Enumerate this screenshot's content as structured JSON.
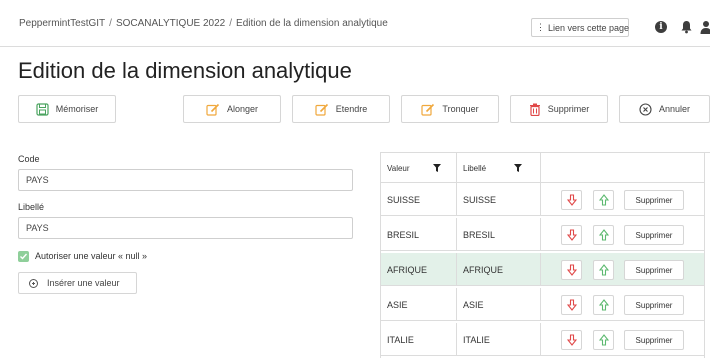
{
  "breadcrumb": [
    "PeppermintTestGIT",
    "SOCANALYTIQUE 2022",
    "Edition de la dimension analytique"
  ],
  "breadcrumb_separator": "/",
  "header": {
    "link_button": "Lien vers cette page",
    "link_icon": "hash-icon"
  },
  "page_title": "Edition de la dimension analytique",
  "toolbar": {
    "memorize": "Mémoriser",
    "lengthen": "Alonger",
    "extend": "Etendre",
    "truncate": "Tronquer",
    "delete": "Supprimer",
    "cancel": "Annuler"
  },
  "form": {
    "code_label": "Code",
    "code_value": "PAYS",
    "libelle_label": "Libellé",
    "libelle_value": "PAYS",
    "allow_null_label": "Autoriser une valeur « null »",
    "allow_null_checked": true,
    "insert_button": "Insérer une valeur"
  },
  "grid": {
    "columns": [
      "Valeur",
      "Libellé"
    ],
    "delete_label": "Supprimer",
    "rows": [
      {
        "valeur": "SUISSE",
        "libelle": "SUISSE",
        "selected": false
      },
      {
        "valeur": "BRESIL",
        "libelle": "BRESIL",
        "selected": false
      },
      {
        "valeur": "AFRIQUE",
        "libelle": "AFRIQUE",
        "selected": true
      },
      {
        "valeur": "ASIE",
        "libelle": "ASIE",
        "selected": false
      },
      {
        "valeur": "ITALIE",
        "libelle": "ITALIE",
        "selected": false
      }
    ]
  },
  "colors": {
    "accent_orange": "#f0a83c",
    "delete_red": "#e04848",
    "up_green": "#5cb96f",
    "selected_row": "#e3f1e9",
    "checkbox_green": "#8fcf9a"
  }
}
